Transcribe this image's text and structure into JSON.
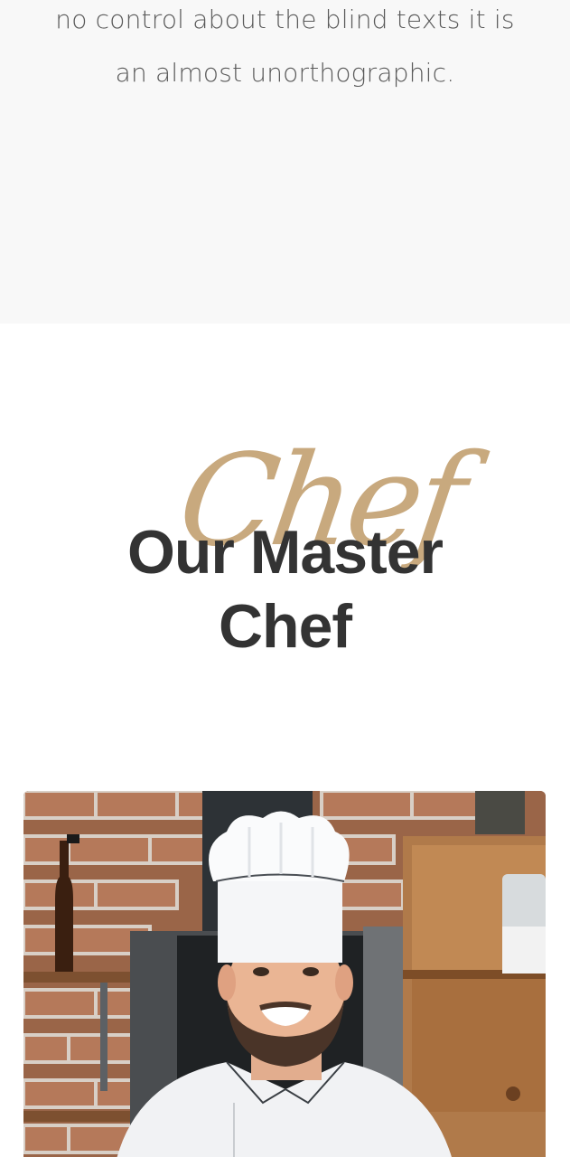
{
  "intro": {
    "line1": "no control about the blind texts it is",
    "line2": "an almost unorthographic."
  },
  "chefs_section": {
    "script_word": "Chef",
    "title_line1": "Our Master",
    "title_line2": "Chef"
  },
  "colors": {
    "accent": "#c8a97e",
    "heading": "#333333",
    "body_text": "#5a5a5a",
    "section_bg": "#f8f8f8"
  }
}
